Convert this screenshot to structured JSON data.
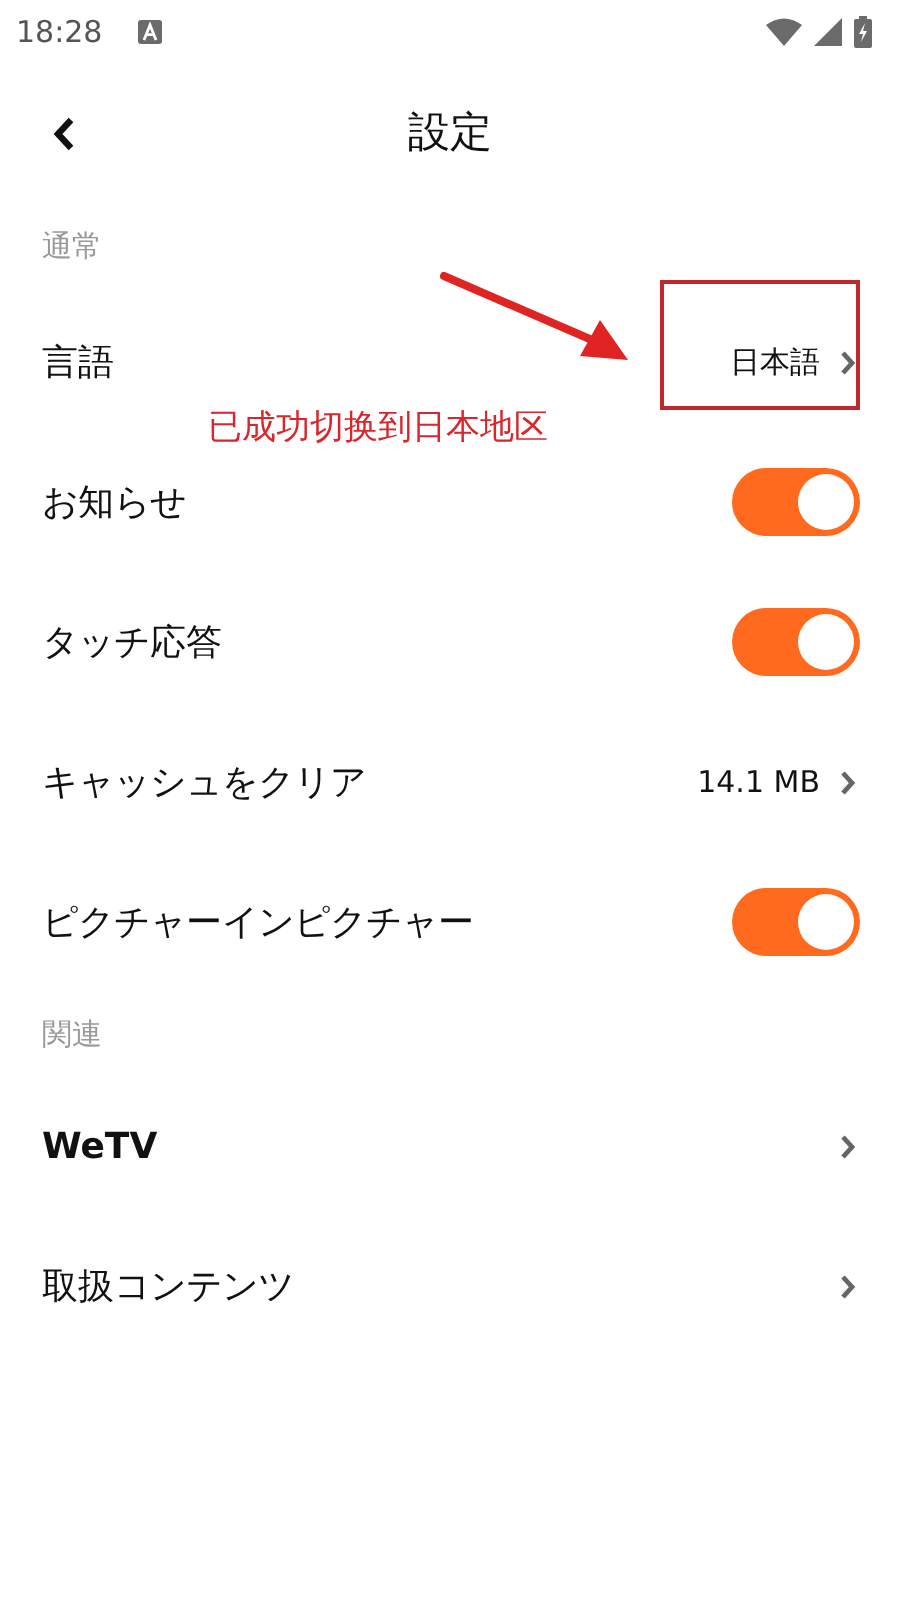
{
  "status_bar": {
    "time": "18:28"
  },
  "header": {
    "title": "設定"
  },
  "sections": [
    {
      "title": "通常",
      "items": [
        {
          "kind": "nav",
          "label": "言語",
          "value": "日本語",
          "bold": false
        },
        {
          "kind": "toggle",
          "label": "お知らせ",
          "on": true
        },
        {
          "kind": "toggle",
          "label": "タッチ応答",
          "on": true
        },
        {
          "kind": "nav",
          "label": "キャッシュをクリア",
          "value": "14.1 MB",
          "bold": false
        },
        {
          "kind": "toggle",
          "label": "ピクチャーインピクチャー",
          "on": true
        }
      ]
    },
    {
      "title": "関連",
      "items": [
        {
          "kind": "nav",
          "label": "WeTV",
          "bold": true
        },
        {
          "kind": "nav",
          "label": "取扱コンテンツ",
          "bold": false
        }
      ]
    }
  ],
  "annotation": {
    "caption": "已成功切换到日本地区"
  }
}
